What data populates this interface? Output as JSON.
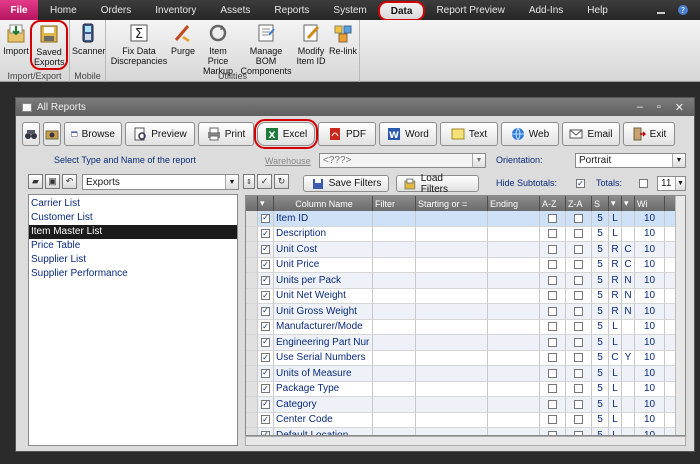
{
  "ribbon": {
    "tabs": [
      "File",
      "Home",
      "Orders",
      "Inventory",
      "Assets",
      "Reports",
      "System",
      "Data",
      "Report Preview",
      "Add-Ins",
      "Help"
    ],
    "active_tab": "Data",
    "groups": {
      "import_export": {
        "label": "Import/Export",
        "buttons": {
          "import": "Import",
          "saved_exports": "Saved Exports"
        }
      },
      "mobile": {
        "label": "Mobile",
        "buttons": {
          "scanner": "Scanner"
        }
      },
      "utilities": {
        "label": "Utilities",
        "buttons": {
          "fix_data": "Fix Data Discrepancies",
          "purge": "Purge",
          "item_price_markup": "Item Price Markup",
          "manage_bom": "Manage BOM Components",
          "modify_item_id": "Modify Item ID",
          "relink": "Re-link"
        }
      }
    }
  },
  "window": {
    "title": "All Reports",
    "toolbar": {
      "browse": "Browse",
      "preview": "Preview",
      "print": "Print",
      "excel": "Excel",
      "pdf": "PDF",
      "word": "Word",
      "text": "Text",
      "web": "Web",
      "email": "Email",
      "exit": "Exit"
    },
    "left": {
      "select_label": "Select Type and Name of the report",
      "type_value": "Exports",
      "reports": [
        "Carrier List",
        "Customer List",
        "Item Master List",
        "Price Table",
        "Supplier List",
        "Supplier Performance"
      ],
      "selected_report": "Item Master List"
    },
    "right": {
      "warehouse_label": "Warehouse",
      "warehouse_value": "<???>",
      "orientation_label": "Orientation:",
      "orientation_value": "Portrait",
      "hide_subtotals_label": "Hide Subtotals:",
      "totals_label": "Totals:",
      "font_size": "11",
      "save_filters": "Save Filters",
      "load_filters": "Load Filters"
    },
    "grid": {
      "headers": [
        "",
        "Column Name",
        "Filter",
        "Starting or =",
        "Ending",
        "A-Z",
        "Z-A",
        "S",
        "",
        "Wi"
      ],
      "rows": [
        {
          "name": "Item ID",
          "s": "5",
          "a": "L",
          "b": "",
          "w": "10",
          "az": false
        },
        {
          "name": "Description",
          "s": "5",
          "a": "L",
          "b": "",
          "w": "10",
          "az": false
        },
        {
          "name": "Unit Cost",
          "s": "5",
          "a": "R",
          "b": "C",
          "w": "10",
          "az": false
        },
        {
          "name": "Unit Price",
          "s": "5",
          "a": "R",
          "b": "C",
          "w": "10",
          "az": false
        },
        {
          "name": "Units per Pack",
          "s": "5",
          "a": "R",
          "b": "N",
          "w": "10",
          "az": false
        },
        {
          "name": "Unit Net Weight",
          "s": "5",
          "a": "R",
          "b": "N",
          "w": "10",
          "az": false
        },
        {
          "name": "Unit Gross Weight",
          "s": "5",
          "a": "R",
          "b": "N",
          "w": "10",
          "az": false
        },
        {
          "name": "Manufacturer/Mode",
          "s": "5",
          "a": "L",
          "b": "",
          "w": "10",
          "az": false
        },
        {
          "name": "Engineering Part Nur",
          "s": "5",
          "a": "L",
          "b": "",
          "w": "10",
          "az": false
        },
        {
          "name": "Use Serial Numbers",
          "s": "5",
          "a": "C",
          "b": "Y",
          "w": "10",
          "az": false
        },
        {
          "name": "Units of Measure",
          "s": "5",
          "a": "L",
          "b": "",
          "w": "10",
          "az": false
        },
        {
          "name": "Package Type",
          "s": "5",
          "a": "L",
          "b": "",
          "w": "10",
          "az": false
        },
        {
          "name": "Category",
          "s": "5",
          "a": "L",
          "b": "",
          "w": "10",
          "az": false
        },
        {
          "name": "Center Code",
          "s": "5",
          "a": "L",
          "b": "",
          "w": "10",
          "az": false
        },
        {
          "name": "Default Location",
          "s": "5",
          "a": "L",
          "b": "",
          "w": "10",
          "az": false
        }
      ]
    }
  }
}
